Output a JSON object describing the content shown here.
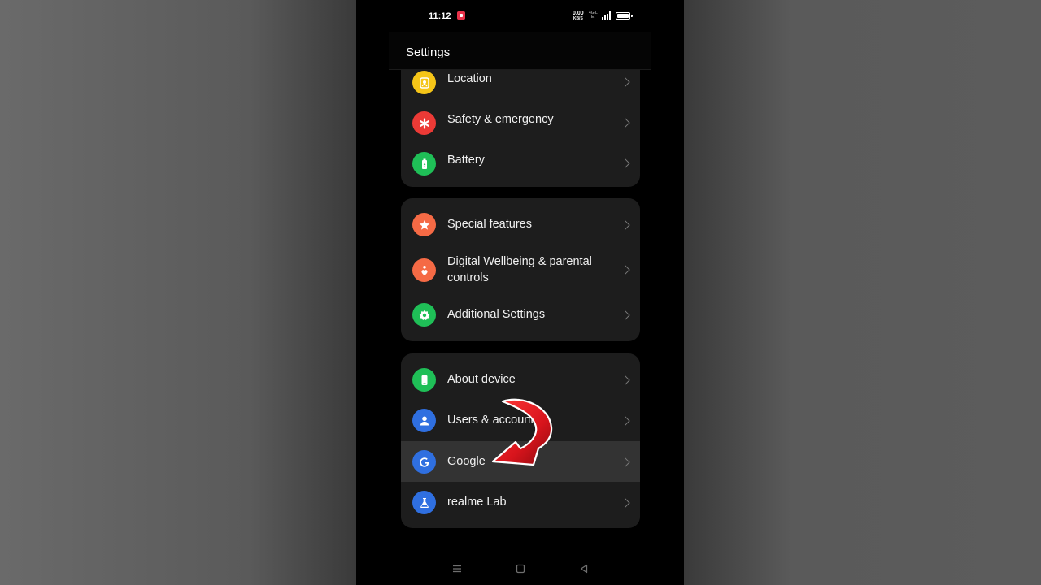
{
  "status_bar": {
    "time": "11:12",
    "net_speed_value": "0.00",
    "net_speed_unit": "KB/S",
    "net_type": "4G LTE"
  },
  "header": {
    "title": "Settings"
  },
  "groups": [
    {
      "items": [
        {
          "label": "Location",
          "icon": "location-icon",
          "color": "#f5c518"
        },
        {
          "label": "Safety & emergency",
          "icon": "asterisk-icon",
          "color": "#ec3a36"
        },
        {
          "label": "Battery",
          "icon": "battery-icon",
          "color": "#1fbf57"
        }
      ]
    },
    {
      "items": [
        {
          "label": "Special features",
          "icon": "star-icon",
          "color": "#f56a45"
        },
        {
          "label": "Digital Wellbeing & parental controls",
          "icon": "wellbeing-icon",
          "color": "#f56a45"
        },
        {
          "label": "Additional Settings",
          "icon": "gear-icon",
          "color": "#1fbf57"
        }
      ]
    },
    {
      "items": [
        {
          "label": "About device",
          "icon": "phone-icon",
          "color": "#1fbf57"
        },
        {
          "label": "Users & accounts",
          "icon": "user-icon",
          "color": "#2f6fe0"
        },
        {
          "label": "Google",
          "icon": "google-icon",
          "color": "#2f6fe0"
        },
        {
          "label": "realme Lab",
          "icon": "flask-icon",
          "color": "#2f6fe0"
        }
      ]
    }
  ],
  "highlighted_item": "Google",
  "nav_bar": {
    "buttons": [
      "menu-icon",
      "home-icon",
      "back-icon"
    ]
  },
  "overlay": {
    "icon": "red-arrow-icon",
    "color": "#d8141c"
  }
}
